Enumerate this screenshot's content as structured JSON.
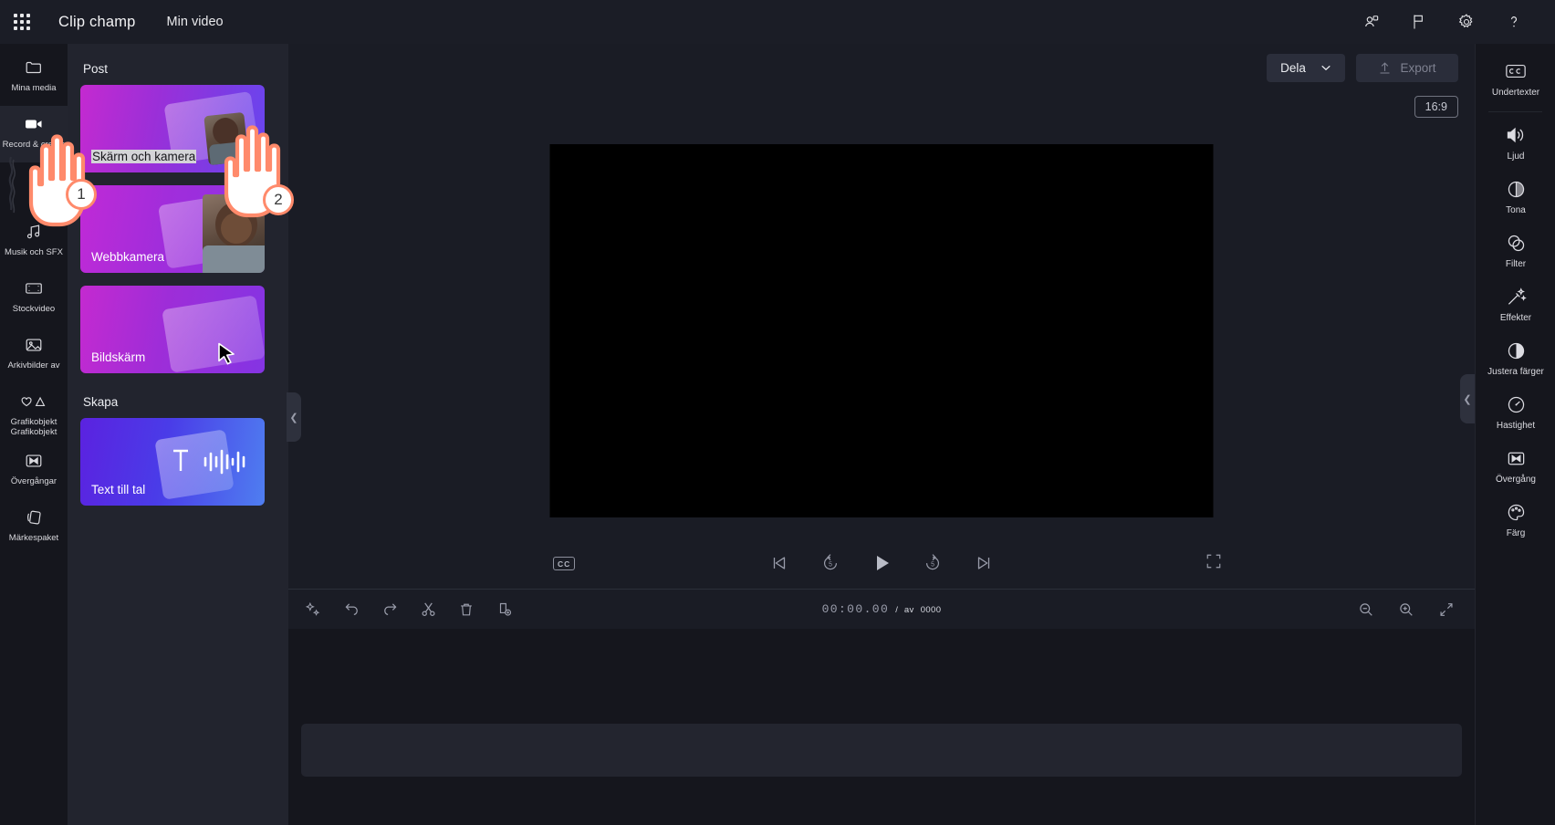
{
  "header": {
    "brand": "Clip champ",
    "project_title": "Min video",
    "waffle_icon": "app-launcher-icon",
    "icons": [
      {
        "name": "share-person-icon",
        "label": "Dela med andra"
      },
      {
        "name": "flag-feedback-icon",
        "label": "Feedback"
      },
      {
        "name": "gear-settings-icon",
        "label": "Inställningar"
      },
      {
        "name": "help-question-icon",
        "label": "Hjälp"
      }
    ]
  },
  "left_rail": {
    "items": [
      {
        "label": "Mina media",
        "icon": "folder-icon",
        "active": false
      },
      {
        "label": "Record & create",
        "icon": "video-camera-icon",
        "active": true
      },
      {
        "label": "Musik och SFX",
        "icon": "music-note-icon",
        "active": false
      },
      {
        "label": "Stockvideo",
        "icon": "film-strip-icon",
        "active": false
      },
      {
        "label": "Arkivbilder av",
        "icon": "image-icon",
        "active": false
      },
      {
        "label": "Grafikobjekt",
        "icon": "shapes-icon",
        "active": false
      },
      {
        "label": "Övergångar",
        "icon": "transition-icon",
        "active": false
      },
      {
        "label": "Märkespaket",
        "icon": "brand-kit-icon",
        "active": false
      }
    ]
  },
  "media_panel": {
    "section_post": "Post",
    "section_skapa": "Skapa",
    "cards": [
      {
        "label": "Skärm och kamera",
        "art": "screen-and-camera",
        "highlighted": true
      },
      {
        "label": "Webbkamera",
        "art": "webcam",
        "highlighted": false
      },
      {
        "label": "Bildskärm",
        "art": "screen",
        "highlighted": false
      },
      {
        "label": "Text till tal",
        "art": "text-to-speech",
        "highlighted": false
      }
    ],
    "collapse_icon": "chevron-left-icon"
  },
  "stage": {
    "share_button": "Dela",
    "share_chevron_icon": "chevron-down-icon",
    "export_button": "Export",
    "export_icon": "upload-arrow-icon",
    "aspect_ratio": "16:9",
    "captions_button": "CC",
    "fullscreen_icon": "fullscreen-icon",
    "playback": [
      {
        "name": "skip-to-start-icon",
        "label": "Början"
      },
      {
        "name": "rewind-5-icon",
        "label": "5"
      },
      {
        "name": "play-icon",
        "label": "Spela upp"
      },
      {
        "name": "forward-5-icon",
        "label": "5"
      },
      {
        "name": "skip-to-end-icon",
        "label": "Slutet"
      }
    ]
  },
  "timeline": {
    "tools": [
      {
        "name": "magic-sparkle-icon",
        "label": "Automatisk"
      },
      {
        "name": "undo-icon",
        "label": "Ångra"
      },
      {
        "name": "redo-icon",
        "label": "Gör om"
      },
      {
        "name": "scissors-split-icon",
        "label": "Dela"
      },
      {
        "name": "trash-delete-icon",
        "label": "Ta bort"
      },
      {
        "name": "duplicate-icon",
        "label": "Duplicera"
      }
    ],
    "current_time": "00:00.00",
    "separator": "/",
    "total_label": "av",
    "total_time": "0000",
    "zoom_tools": [
      {
        "name": "zoom-out-icon",
        "label": "Zooma ut"
      },
      {
        "name": "zoom-in-icon",
        "label": "Zooma in"
      },
      {
        "name": "fit-to-screen-icon",
        "label": "Anpassa"
      }
    ]
  },
  "right_rail": {
    "items": [
      {
        "label": "Undertexter",
        "icon": "closed-captions-icon",
        "divider_after": true
      },
      {
        "label": "Ljud",
        "icon": "speaker-volume-icon",
        "divider_after": false
      },
      {
        "label": "Tona",
        "icon": "fade-circle-icon",
        "divider_after": false
      },
      {
        "label": "Filter",
        "icon": "filter-circles-icon",
        "divider_after": false
      },
      {
        "label": "Effekter",
        "icon": "magic-wand-effects-icon",
        "divider_after": false
      },
      {
        "label": "Justera färger",
        "icon": "contrast-half-circle-icon",
        "divider_after": false
      },
      {
        "label": "Hastighet",
        "icon": "speedometer-icon",
        "divider_after": false
      },
      {
        "label": "Övergång",
        "icon": "transition-icon",
        "divider_after": false
      },
      {
        "label": "Färg",
        "icon": "color-palette-icon",
        "divider_after": false
      }
    ],
    "collapse_icon": "chevron-left-icon"
  },
  "tutorial": {
    "steps": [
      {
        "number": "1",
        "target": "record-and-create-rail-item"
      },
      {
        "number": "2",
        "target": "screen-and-camera-card"
      }
    ],
    "accent_color": "#ff8a6b"
  },
  "colors": {
    "app_bg": "#15161d",
    "header_bg": "#1b1d26",
    "panel_bg": "#22242e",
    "stage_bg": "#1a1c25",
    "preview_bg": "#000000",
    "text_primary": "#eceef2",
    "text_muted": "#9a9dab",
    "card_purple": "#9b2fd8",
    "card_blue": "#4a3ce8"
  }
}
